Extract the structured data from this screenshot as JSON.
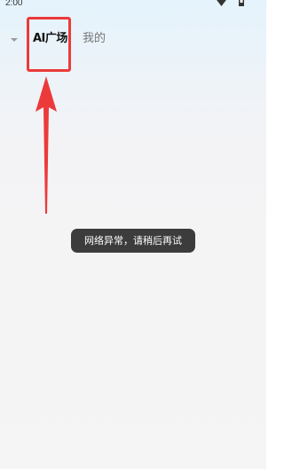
{
  "status_bar": {
    "time": "2:00",
    "icons": [
      "wifi-icon",
      "battery-icon"
    ]
  },
  "header": {
    "back_icon": "chevron-down-icon",
    "tabs": [
      {
        "label": "AI广场",
        "active": true
      },
      {
        "label": "我的",
        "active": false
      }
    ]
  },
  "toast": {
    "message": "网络异常，请稍后再试"
  },
  "colors": {
    "annotation": "#ec3a3a",
    "toast_bg": "#3c3c3c",
    "active_tab": "#111111",
    "inactive_tab": "#777777"
  }
}
